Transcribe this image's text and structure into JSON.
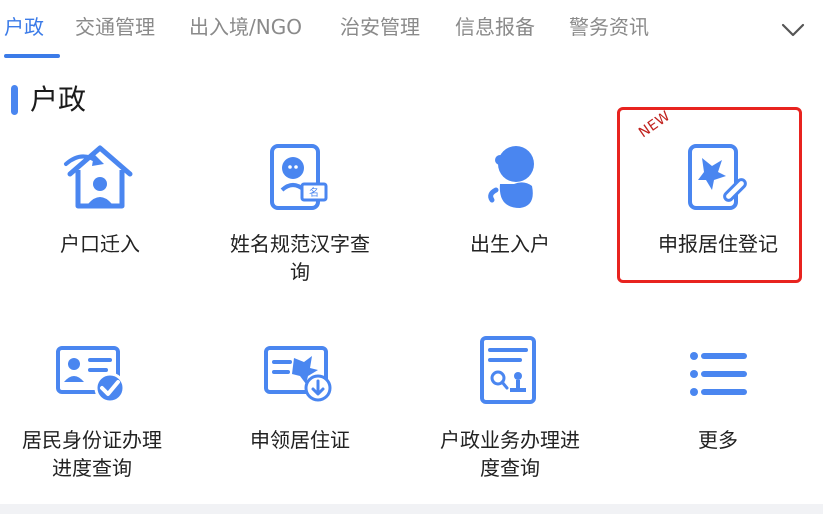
{
  "tabs": [
    {
      "label": "户政",
      "active": true
    },
    {
      "label": "交通管理",
      "active": false
    },
    {
      "label": "出入境/NGO",
      "active": false
    },
    {
      "label": "治安管理",
      "active": false
    },
    {
      "label": "信息报备",
      "active": false
    },
    {
      "label": "警务资讯",
      "active": false
    }
  ],
  "section": {
    "title": "户政"
  },
  "tiles": [
    {
      "label_line1": "户口迁入",
      "label_line2": "",
      "icon": "house-transfer-icon"
    },
    {
      "label_line1": "姓名规范汉字查",
      "label_line2": "询",
      "icon": "name-lookup-icon"
    },
    {
      "label_line1": "出生入户",
      "label_line2": "",
      "icon": "baby-icon"
    },
    {
      "label_line1": "申报居住登记",
      "label_line2": "",
      "icon": "residence-register-icon",
      "badge": "NEW"
    },
    {
      "label_line1": "居民身份证办理",
      "label_line2": "进度查询",
      "icon": "id-card-check-icon"
    },
    {
      "label_line1": "申领居住证",
      "label_line2": "",
      "icon": "residence-permit-icon"
    },
    {
      "label_line1": "户政业务办理进",
      "label_line2": "度查询",
      "icon": "document-search-icon"
    },
    {
      "label_line1": "更多",
      "label_line2": "",
      "icon": "more-list-icon"
    }
  ],
  "colors": {
    "accent": "#3b7be8",
    "highlight": "#e8231f",
    "badge": "#c0211d"
  }
}
